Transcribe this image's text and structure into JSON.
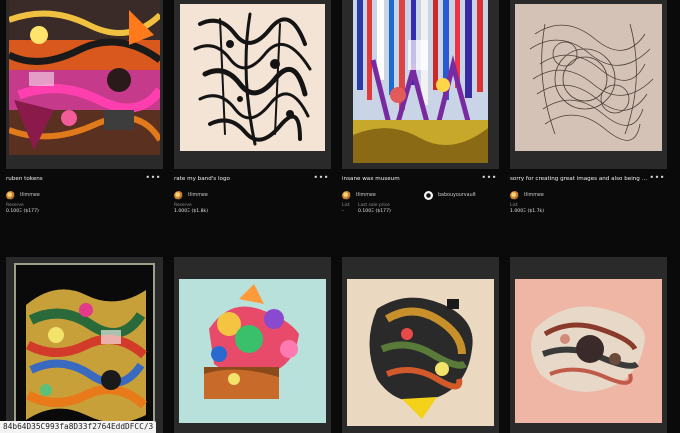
{
  "cards": [
    {
      "title": "ruben tokens",
      "creator": "tlimmee",
      "price_label": "Reserve",
      "price_value": "0.100Ξ ($177)",
      "art_icon": "collage-artwork",
      "art_bg": "#b8322a"
    },
    {
      "title": "rate my band's logo",
      "creator": "tlimmee",
      "price_label": "Reserve",
      "price_value": "1.000Ξ ($1.8k)",
      "art_icon": "ink-drawing-artwork",
      "art_bg": "#f3e4d6"
    },
    {
      "title": "insane wax museum",
      "creator": "tlimmee",
      "owner": "babouyourvault",
      "price_label": "List",
      "price_value": "-",
      "sale_label": "Last sale price",
      "sale_value": "0.100Ξ ($177)",
      "art_icon": "wax-museum-artwork",
      "art_bg": "#c9d4e6"
    },
    {
      "title": "sorry for creating great images and also being cool and also wearing a hat",
      "creator": "tlimmee",
      "price_label": "List",
      "price_value": "1.000Ξ ($1.7k)",
      "art_icon": "line-sketch-artwork",
      "art_bg": "#d4c2b6"
    },
    {
      "title": "",
      "art_icon": "dense-collage-artwork",
      "art_bg": "#0a0a0a"
    },
    {
      "title": "",
      "art_icon": "floral-collage-artwork",
      "art_bg": "#b9e1db"
    },
    {
      "title": "",
      "art_icon": "fragment-collage-artwork",
      "art_bg": "#ead8c0"
    },
    {
      "title": "",
      "art_icon": "nest-collage-artwork",
      "art_bg": "#efb5a5"
    }
  ],
  "statusbar": {
    "text": "84b64D35C993fa8D33f2764EddDFCC/3"
  },
  "colors": {
    "page_bg": "#0a0a0a",
    "card_bg": "#2a2a2a",
    "muted_text": "#8f8f8f"
  }
}
